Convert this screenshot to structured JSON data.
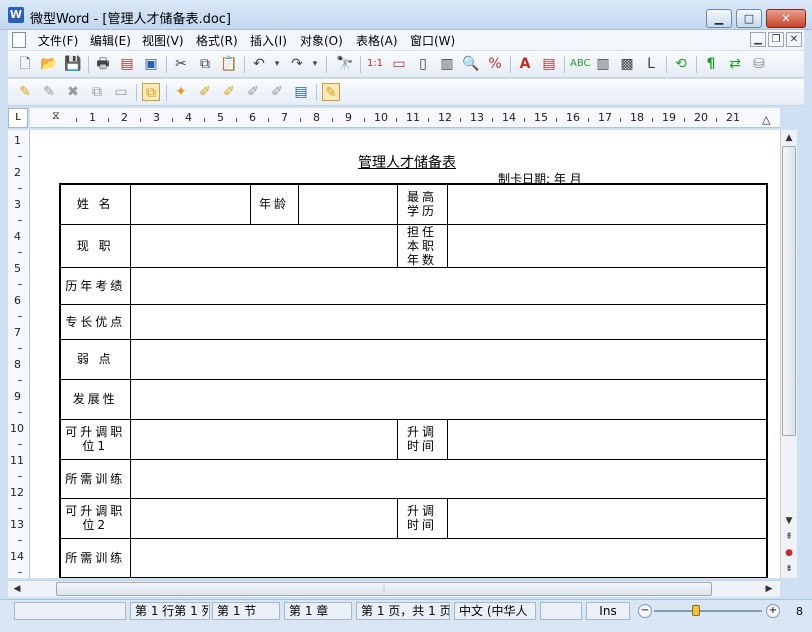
{
  "window": {
    "title": "微型Word - [管理人才储备表.doc]",
    "app_icon": "W"
  },
  "menu": [
    "文件(F)",
    "编辑(E)",
    "视图(V)",
    "格式(R)",
    "插入(I)",
    "对象(O)",
    "表格(A)",
    "窗口(W)"
  ],
  "horizontal_ruler": [
    "1",
    "2",
    "3",
    "4",
    "5",
    "6",
    "7",
    "8",
    "9",
    "10",
    "11",
    "12",
    "13",
    "14",
    "15",
    "16",
    "17",
    "18",
    "19",
    "20",
    "21"
  ],
  "vertical_ruler": [
    "1",
    "2",
    "3",
    "4",
    "5",
    "6",
    "7",
    "8",
    "9",
    "10",
    "11",
    "12",
    "13",
    "14"
  ],
  "document": {
    "title": "管理人才储备表",
    "date_label": "制卡日期:  年  月",
    "labels": {
      "name": "姓 名",
      "age": "年龄",
      "education": "最高学历",
      "position": "现 职",
      "tenure": "担任本职年数",
      "performance": "历年考绩",
      "strengths": "专长优点",
      "weakness": "弱 点",
      "potential": "发展性",
      "promotable1": "可升调职位1",
      "promotion_time1": "升调时间",
      "training1": "所需训练",
      "promotable2": "可升调职位2",
      "promotion_time2": "升调时间",
      "training2": "所需训练"
    }
  },
  "statusbar": {
    "position": "第 1 行第 1 列",
    "section": "第 1 节",
    "chapter": "第 1 章",
    "page": "第 1 页，共 1 页",
    "language": "中文 (中华人",
    "mode": "Ins",
    "zoom_value": "8"
  }
}
